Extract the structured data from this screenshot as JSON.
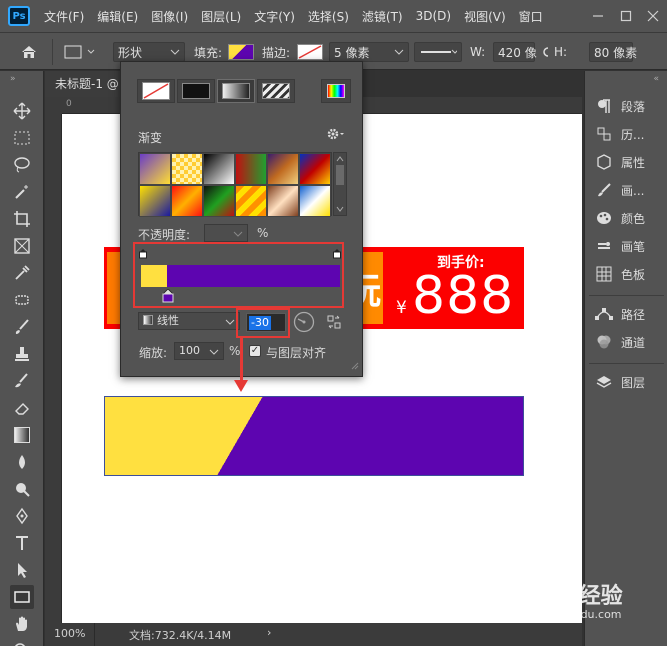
{
  "app": {
    "logo_text": "Ps"
  },
  "menu": {
    "items": [
      "文件(F)",
      "编辑(E)",
      "图像(I)",
      "图层(L)",
      "文字(Y)",
      "选择(S)",
      "滤镜(T)",
      "3D(D)",
      "视图(V)",
      "窗口"
    ],
    "window_controls": [
      "minimize-icon",
      "maximize-icon",
      "close-icon"
    ]
  },
  "options_bar": {
    "shape_mode": "形状",
    "fill_label": "填充:",
    "stroke_label": "描边:",
    "stroke_width": "5 像素",
    "w_label": "W:",
    "w_value": "420 像",
    "h_label": "H:",
    "h_value": "80 像素",
    "link_icon": "link-icon"
  },
  "document": {
    "tab_title": "未标题-1 @",
    "ruler_zero": "0",
    "zoom": "100%",
    "doc_info": "文档:732.4K/4.14M",
    "status_arrow": "›"
  },
  "canvas_content": {
    "ghost_char": "抏",
    "price_label": "到手价:",
    "currency": "¥",
    "price": "888",
    "colors": {
      "red": "#fc0000",
      "orange": "#ff7a00",
      "yellow": "#ffe040",
      "purple": "#5d05b0"
    }
  },
  "gradient_popup": {
    "fill_types": [
      "no-fill",
      "solid-color",
      "gradient",
      "pattern"
    ],
    "picker_icon": "color-picker-icon",
    "section_title": "渐变",
    "settings_icon": "gear-icon",
    "presets": [
      "linear-gradient(135deg,#6a3cc7,#ffdd33)",
      "repeating-conic-gradient(#ffcc33 0 25%,#fff2b0 0 50%) 0 0/8px 8px",
      "linear-gradient(135deg,#000,#fff)",
      "linear-gradient(90deg,#c01010,#20a030)",
      "linear-gradient(135deg,#3a1d6e,#c06a20,#f0d080)",
      "linear-gradient(135deg,#0030c0,#c00000,#ffd000)",
      "linear-gradient(135deg,#ffe000,#1a1aa0)",
      "linear-gradient(135deg,#ff1010,#ffb000,#ff1010)",
      "linear-gradient(135deg,#101010,#20a020,#c01010)",
      "repeating-linear-gradient(135deg,#ff9000 0 6px,#ffe000 6px 12px)",
      "linear-gradient(135deg,#804020,#ffe0c0,#804020)",
      "linear-gradient(135deg,#1060d0,#ffffff,#ffe000)"
    ],
    "opacity_label": "不透明度:",
    "opacity_unit": "%",
    "gradient_stops": {
      "start": "#ffe040",
      "end": "#5d05b0"
    },
    "style_label": "线性",
    "angle_value": "-30",
    "scale_label": "缩放:",
    "scale_value": "100",
    "scale_unit": "%",
    "align_label": "与图层对齐",
    "align_checked": true
  },
  "right_panel": {
    "items": [
      {
        "icon": "paragraph-icon",
        "label": "段落"
      },
      {
        "icon": "history-icon",
        "label": "历..."
      },
      {
        "icon": "properties-icon",
        "label": "属性"
      },
      {
        "icon": "brush-settings-icon",
        "label": "画..."
      },
      {
        "icon": "color-icon",
        "label": "颜色"
      },
      {
        "icon": "brush-icon",
        "label": "画笔"
      },
      {
        "icon": "swatches-icon",
        "label": "色板"
      },
      {
        "icon": "paths-icon",
        "label": "路径"
      },
      {
        "icon": "channels-icon",
        "label": "通道"
      },
      {
        "icon": "layers-icon",
        "label": "图层"
      }
    ]
  },
  "watermark": {
    "logo": "Baidu经验",
    "url": "jingyan.baidu.com"
  }
}
